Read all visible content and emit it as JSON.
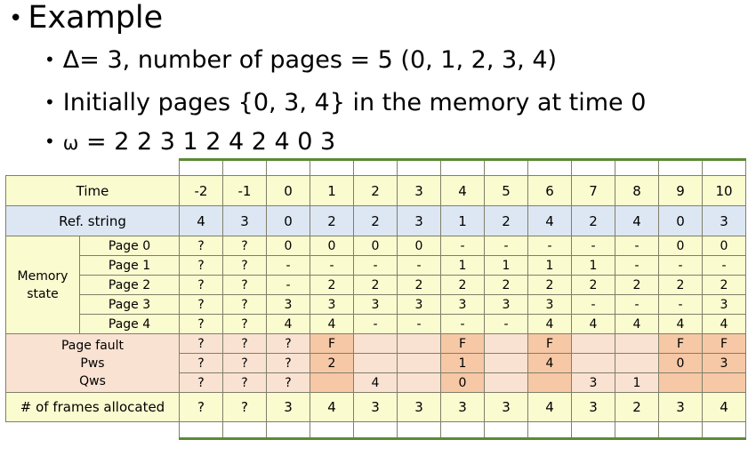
{
  "slide": {
    "title": "Example",
    "bullets": [
      "Δ= 3, number of pages = 5 (0, 1, 2, 3, 4)",
      "Initially pages {0, 3, 4} in the memory at time 0"
    ],
    "omega_symbol": "ω",
    "omega_value": "= 2 2 3 1 2 4 2 4 0 3",
    "bullet_glyph": "•"
  },
  "table": {
    "row_labels": {
      "time": "Time",
      "ref_string": "Ref. string",
      "memory_state": "Memory state",
      "memory_state_line1": "Memory",
      "memory_state_line2": "state",
      "page_fault": "Page fault",
      "pws": "Pws",
      "qws": "Qws",
      "frames": "# of frames allocated"
    },
    "page_labels": [
      "Page 0",
      "Page 1",
      "Page 2",
      "Page 3",
      "Page 4"
    ],
    "time": [
      "-2",
      "-1",
      "0",
      "1",
      "2",
      "3",
      "4",
      "5",
      "6",
      "7",
      "8",
      "9",
      "10"
    ],
    "ref_string": [
      "4",
      "3",
      "0",
      "2",
      "2",
      "3",
      "1",
      "2",
      "4",
      "2",
      "4",
      "0",
      "3"
    ],
    "memory_state": [
      [
        "?",
        "?",
        "0",
        "0",
        "0",
        "0",
        "-",
        "-",
        "-",
        "-",
        "-",
        "0",
        "0"
      ],
      [
        "?",
        "?",
        "-",
        "-",
        "-",
        "-",
        "1",
        "1",
        "1",
        "1",
        "-",
        "-",
        "-"
      ],
      [
        "?",
        "?",
        "-",
        "2",
        "2",
        "2",
        "2",
        "2",
        "2",
        "2",
        "2",
        "2",
        "2"
      ],
      [
        "?",
        "?",
        "3",
        "3",
        "3",
        "3",
        "3",
        "3",
        "3",
        "-",
        "-",
        "-",
        "3"
      ],
      [
        "?",
        "?",
        "4",
        "4",
        "-",
        "-",
        "-",
        "-",
        "4",
        "4",
        "4",
        "4",
        "4"
      ]
    ],
    "page_fault": [
      "?",
      "?",
      "?",
      "F",
      "",
      "",
      "F",
      "",
      "F",
      "",
      "",
      "F",
      "F"
    ],
    "pws": [
      "?",
      "?",
      "?",
      "2",
      "",
      "",
      "1",
      "",
      "4",
      "",
      "",
      "0",
      "3"
    ],
    "qws": [
      "?",
      "?",
      "?",
      "",
      "4",
      "",
      "0",
      "",
      "",
      "3",
      "1",
      "",
      ""
    ],
    "fault_highlight": [
      false,
      false,
      false,
      true,
      false,
      false,
      true,
      false,
      true,
      false,
      false,
      true,
      true
    ],
    "frames": [
      "?",
      "?",
      "3",
      "4",
      "3",
      "3",
      "3",
      "3",
      "4",
      "3",
      "2",
      "3",
      "4"
    ]
  },
  "colors": {
    "yellow": "#fbfbd0",
    "blue": "#dde7f3",
    "peach": "#fae2d2",
    "peach_highlight": "#f6c8a5",
    "grid_green": "#5b8a35",
    "border_gray": "#7f7f6a"
  }
}
